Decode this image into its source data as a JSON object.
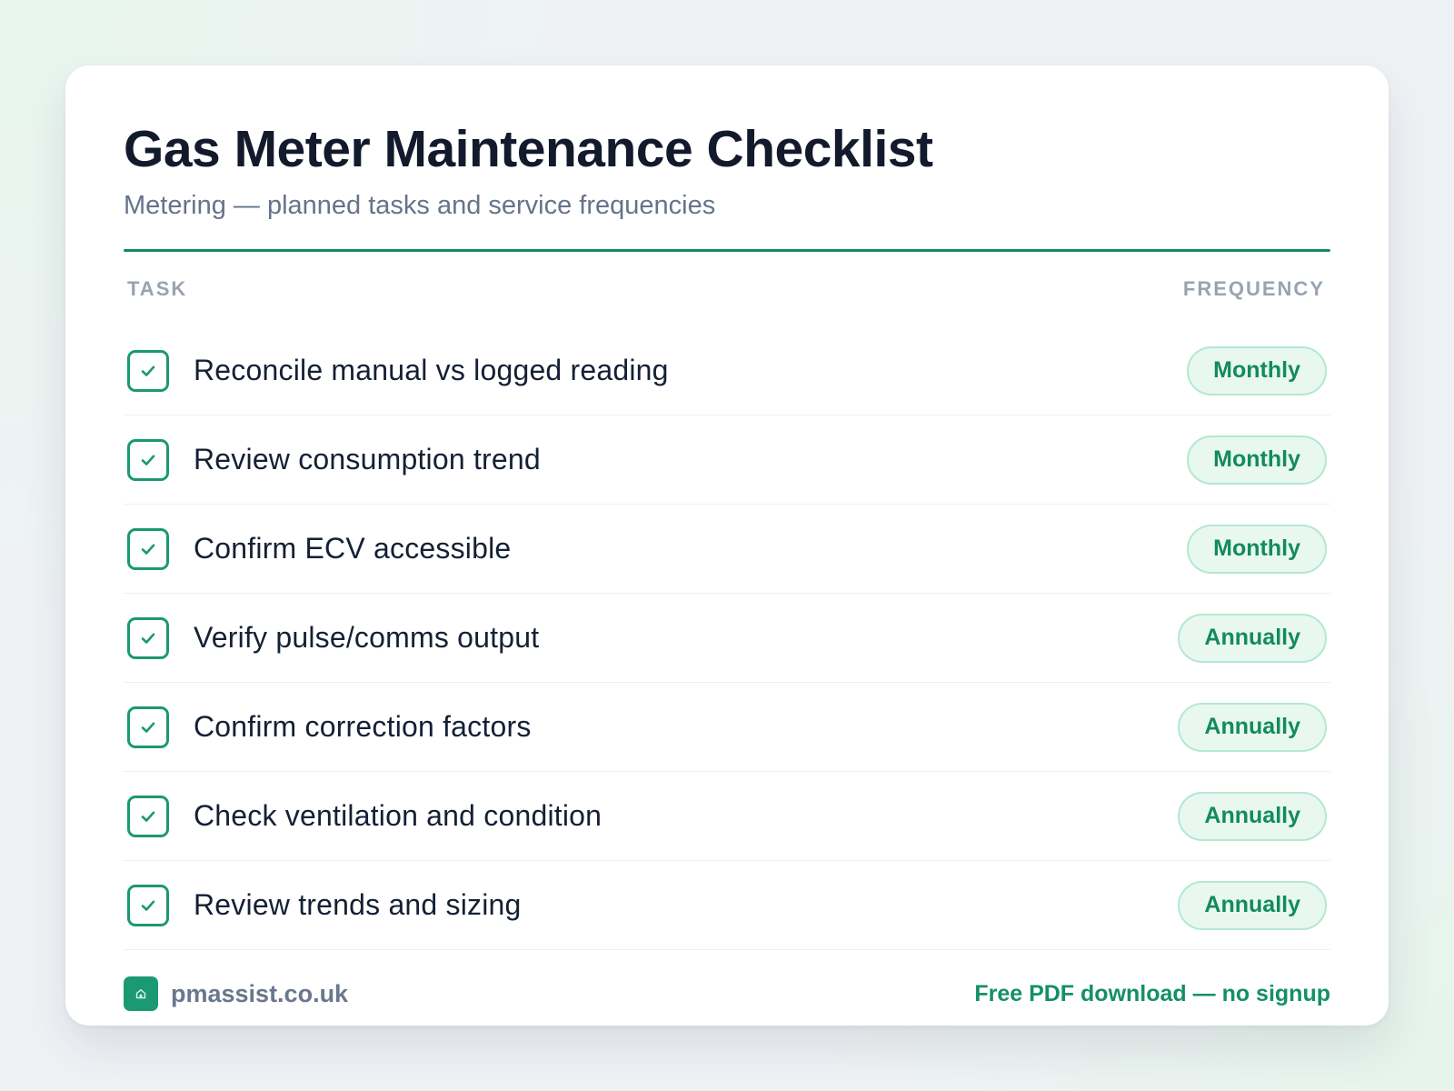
{
  "header": {
    "title": "Gas Meter Maintenance Checklist",
    "subtitle": "Metering — planned tasks and service frequencies"
  },
  "columns": {
    "task": "TASK",
    "frequency": "FREQUENCY"
  },
  "tasks": [
    {
      "label": "Reconcile manual vs logged reading",
      "frequency": "Monthly",
      "checked": true
    },
    {
      "label": "Review consumption trend",
      "frequency": "Monthly",
      "checked": true
    },
    {
      "label": "Confirm ECV accessible",
      "frequency": "Monthly",
      "checked": true
    },
    {
      "label": "Verify pulse/comms output",
      "frequency": "Annually",
      "checked": true
    },
    {
      "label": "Confirm correction factors",
      "frequency": "Annually",
      "checked": true
    },
    {
      "label": "Check ventilation and condition",
      "frequency": "Annually",
      "checked": true
    },
    {
      "label": "Review trends and sizing",
      "frequency": "Annually",
      "checked": true
    }
  ],
  "footer": {
    "brand": "pmassist.co.uk",
    "cta": "Free PDF download — no signup"
  },
  "colors": {
    "accent": "#168a62",
    "pill_bg": "#e8f8f0",
    "pill_border": "#b4e8cf",
    "title": "#121a2c"
  },
  "icons": {
    "checkbox": "checkmark-icon",
    "brand": "house-icon"
  }
}
